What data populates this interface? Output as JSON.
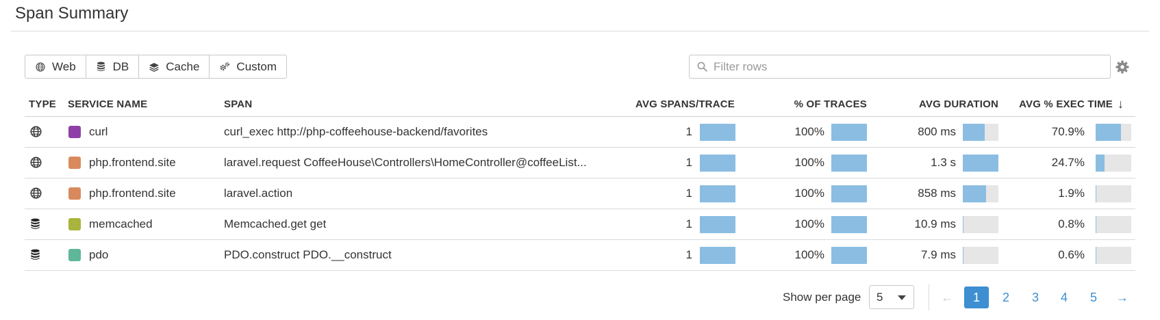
{
  "header": {
    "title": "Span Summary"
  },
  "filters": [
    {
      "label": "Web",
      "icon": "globe-icon"
    },
    {
      "label": "DB",
      "icon": "database-icon"
    },
    {
      "label": "Cache",
      "icon": "layers-icon"
    },
    {
      "label": "Custom",
      "icon": "cogs-icon"
    }
  ],
  "search": {
    "placeholder": "Filter rows",
    "value": ""
  },
  "settings": {
    "icon": "gear-icon"
  },
  "table": {
    "columns": [
      "TYPE",
      "SERVICE NAME",
      "SPAN",
      "AVG SPANS/TRACE",
      "% OF TRACES",
      "AVG DURATION",
      "AVG % EXEC TIME"
    ],
    "sort": {
      "column": "AVG % EXEC TIME",
      "direction": "desc",
      "arrow": "↓"
    },
    "rows": [
      {
        "type": "web",
        "type_icon": "globe-icon",
        "service": "curl",
        "service_color": "#8e3fa8",
        "span": "curl_exec http://php-coffeehouse-backend/favorites",
        "avg_spans": "1",
        "avg_spans_level": 1.0,
        "pct_traces": "100%",
        "pct_traces_level": 1.0,
        "avg_duration": "800 ms",
        "avg_duration_level": 0.62,
        "avg_exec": "70.9%",
        "avg_exec_level": 0.709
      },
      {
        "type": "web",
        "type_icon": "globe-icon",
        "service": "php.frontend.site",
        "service_color": "#d98a5c",
        "span": "laravel.request CoffeeHouse\\Controllers\\HomeController@coffeeList...",
        "avg_spans": "1",
        "avg_spans_level": 1.0,
        "pct_traces": "100%",
        "pct_traces_level": 1.0,
        "avg_duration": "1.3 s",
        "avg_duration_level": 1.0,
        "avg_exec": "24.7%",
        "avg_exec_level": 0.247
      },
      {
        "type": "web",
        "type_icon": "globe-icon",
        "service": "php.frontend.site",
        "service_color": "#d98a5c",
        "span": "laravel.action",
        "avg_spans": "1",
        "avg_spans_level": 1.0,
        "pct_traces": "100%",
        "pct_traces_level": 1.0,
        "avg_duration": "858 ms",
        "avg_duration_level": 0.66,
        "avg_exec": "1.9%",
        "avg_exec_level": 0.019
      },
      {
        "type": "db",
        "type_icon": "database-icon",
        "service": "memcached",
        "service_color": "#a9b43c",
        "span": "Memcached.get get",
        "avg_spans": "1",
        "avg_spans_level": 1.0,
        "pct_traces": "100%",
        "pct_traces_level": 1.0,
        "avg_duration": "10.9 ms",
        "avg_duration_level": 0.008,
        "avg_exec": "0.8%",
        "avg_exec_level": 0.008
      },
      {
        "type": "db",
        "type_icon": "database-icon",
        "service": "pdo",
        "service_color": "#5fb79a",
        "span": "PDO.construct PDO.__construct",
        "avg_spans": "1",
        "avg_spans_level": 1.0,
        "pct_traces": "100%",
        "pct_traces_level": 1.0,
        "avg_duration": "7.9 ms",
        "avg_duration_level": 0.006,
        "avg_exec": "0.6%",
        "avg_exec_level": 0.006
      }
    ]
  },
  "pagination": {
    "show_per_page_label": "Show per page",
    "per_page_value": "5",
    "prev": "←",
    "next": "→",
    "pages": [
      "1",
      "2",
      "3",
      "4",
      "5"
    ],
    "current_page": "1"
  },
  "colors": {
    "bar_fill": "#8bbde2",
    "bar_track": "#e6e6e6",
    "accent": "#3d8fd1"
  }
}
